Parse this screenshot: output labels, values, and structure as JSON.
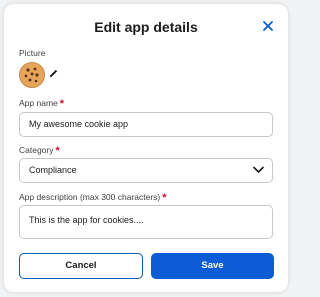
{
  "dialog": {
    "title": "Edit app details"
  },
  "picture": {
    "label": "Picture",
    "icon": "cookie-icon"
  },
  "app_name": {
    "label": "App name",
    "required_mark": "*",
    "value": "My awesome cookie app"
  },
  "category": {
    "label": "Category",
    "required_mark": "*",
    "value": "Compliance"
  },
  "description": {
    "label": "App description (max 300 characters)",
    "required_mark": "*",
    "value": "This is the app for cookies...."
  },
  "buttons": {
    "cancel_label": "Cancel",
    "save_label": "Save"
  },
  "colors": {
    "accent": "#0b5cd5",
    "required": "#c8102e",
    "border": "#c4c7cc"
  }
}
